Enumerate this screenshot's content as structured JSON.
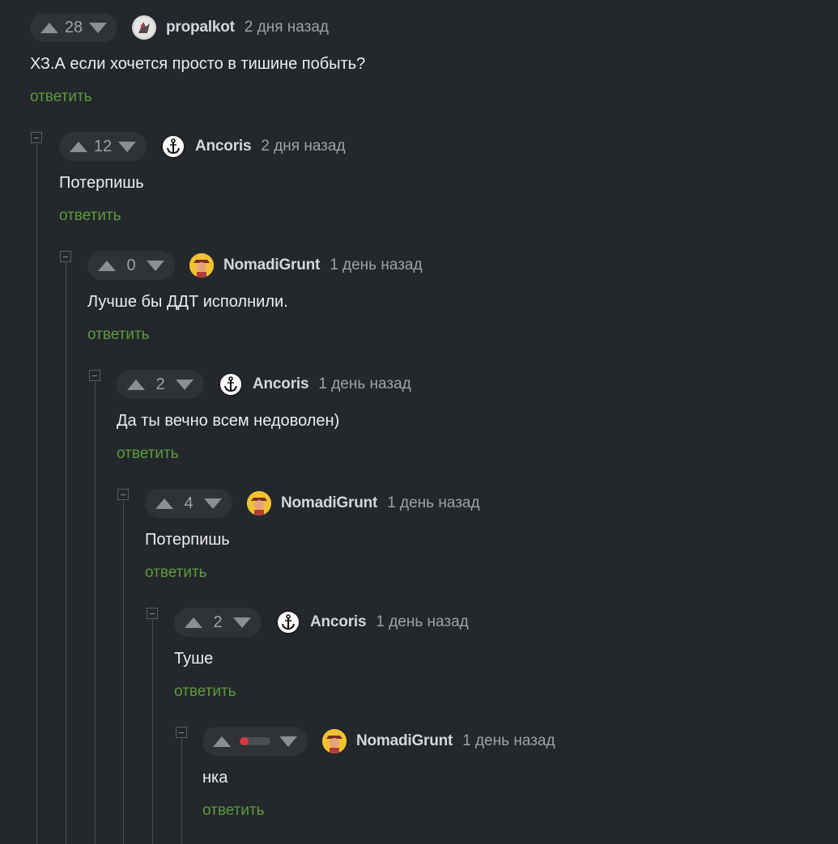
{
  "comments": [
    {
      "rating": "28",
      "username": "propalkot",
      "time": "2 дня назад",
      "text": "ХЗ.А если хочется просто в тишине побыть?",
      "reply": "ответить",
      "avatar": "propalkot-avatar"
    },
    {
      "rating": "12",
      "username": "Ancoris",
      "time": "2 дня назад",
      "text": "Потерпишь",
      "reply": "ответить",
      "avatar": "anchor-avatar"
    },
    {
      "rating": "0",
      "username": "NomadiGrunt",
      "time": "1 день назад",
      "text": "Лучше бы ДДТ исполнили.",
      "reply": "ответить",
      "avatar": "nomadi-avatar"
    },
    {
      "rating": "2",
      "username": "Ancoris",
      "time": "1 день назад",
      "text": "Да ты вечно всем недоволен)",
      "reply": "ответить",
      "avatar": "anchor-avatar"
    },
    {
      "rating": "4",
      "username": "NomadiGrunt",
      "time": "1 день назад",
      "text": "Потерпишь",
      "reply": "ответить",
      "avatar": "nomadi-avatar"
    },
    {
      "rating": "2",
      "username": "Ancoris",
      "time": "1 день назад",
      "text": "Туше",
      "reply": "ответить",
      "avatar": "anchor-avatar"
    },
    {
      "rating_bar": 0.3,
      "username": "NomadiGrunt",
      "time": "1 день назад",
      "text": "нка",
      "reply": "ответить",
      "avatar": "nomadi-avatar"
    }
  ],
  "colors": {
    "background": "#24272c",
    "reply_link": "#5d9a3c",
    "rating_negative": "#d8383f"
  }
}
